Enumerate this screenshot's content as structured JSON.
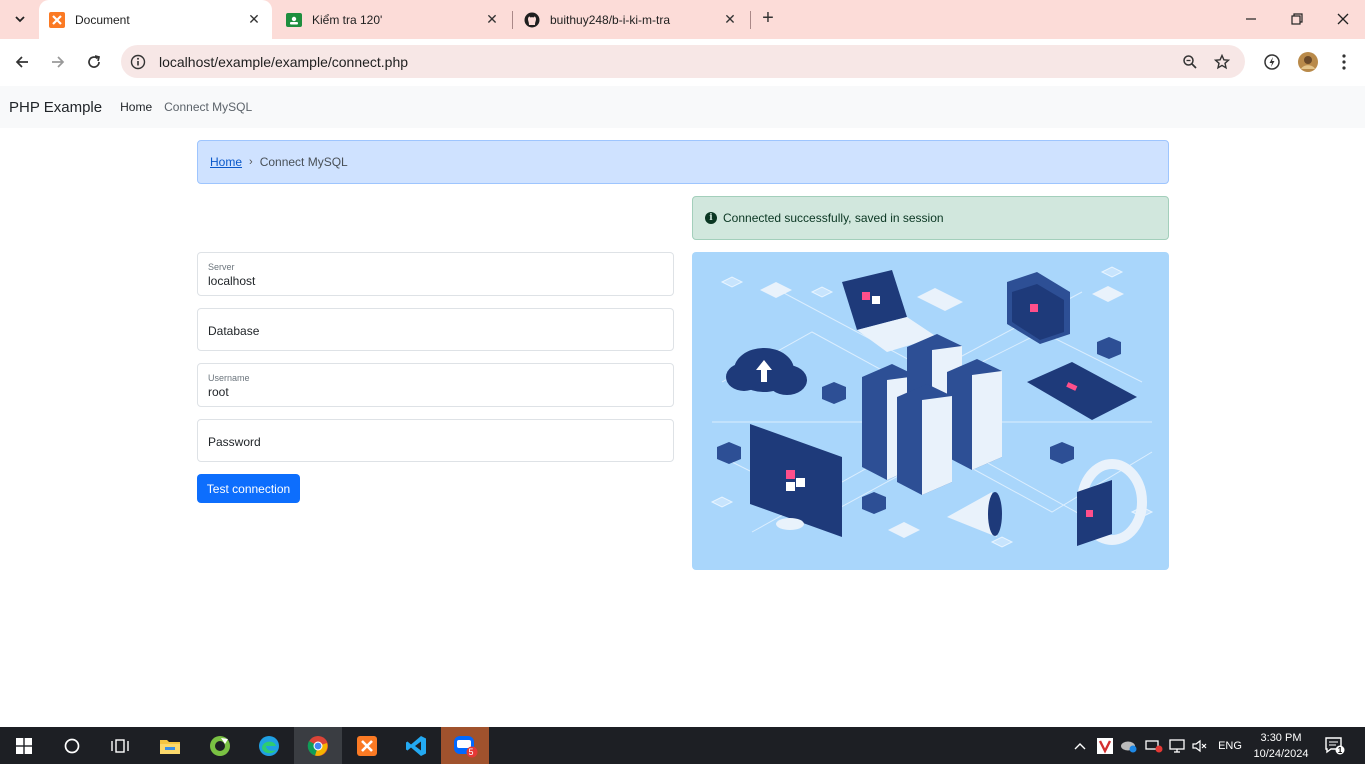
{
  "browser": {
    "tabs": [
      {
        "title": "Document",
        "active": true
      },
      {
        "title": "Kiểm tra 120'",
        "active": false
      },
      {
        "title": "buithuy248/b-i-ki-m-tra",
        "active": false
      }
    ],
    "address": "localhost/example/example/connect.php"
  },
  "navbar": {
    "brand": "PHP Example",
    "links": [
      "Home",
      "Connect MySQL"
    ]
  },
  "breadcrumb": {
    "home": "Home",
    "separator": "›",
    "current": "Connect MySQL"
  },
  "alert": {
    "text": "Connected successfully, saved in session",
    "color": "#d1e7dd"
  },
  "form": {
    "server": {
      "label": "Server",
      "value": "localhost"
    },
    "database": {
      "placeholder": "Database"
    },
    "username": {
      "label": "Username",
      "value": "root"
    },
    "password": {
      "placeholder": "Password"
    },
    "submit": "Test connection"
  },
  "taskbar": {
    "language": "ENG",
    "time": "3:30 PM",
    "date": "10/24/2024",
    "zalo_badge": "5",
    "notification_count": "1"
  },
  "colors": {
    "primary": "#0d6efd",
    "tabstrip": "#fcdcd8"
  }
}
